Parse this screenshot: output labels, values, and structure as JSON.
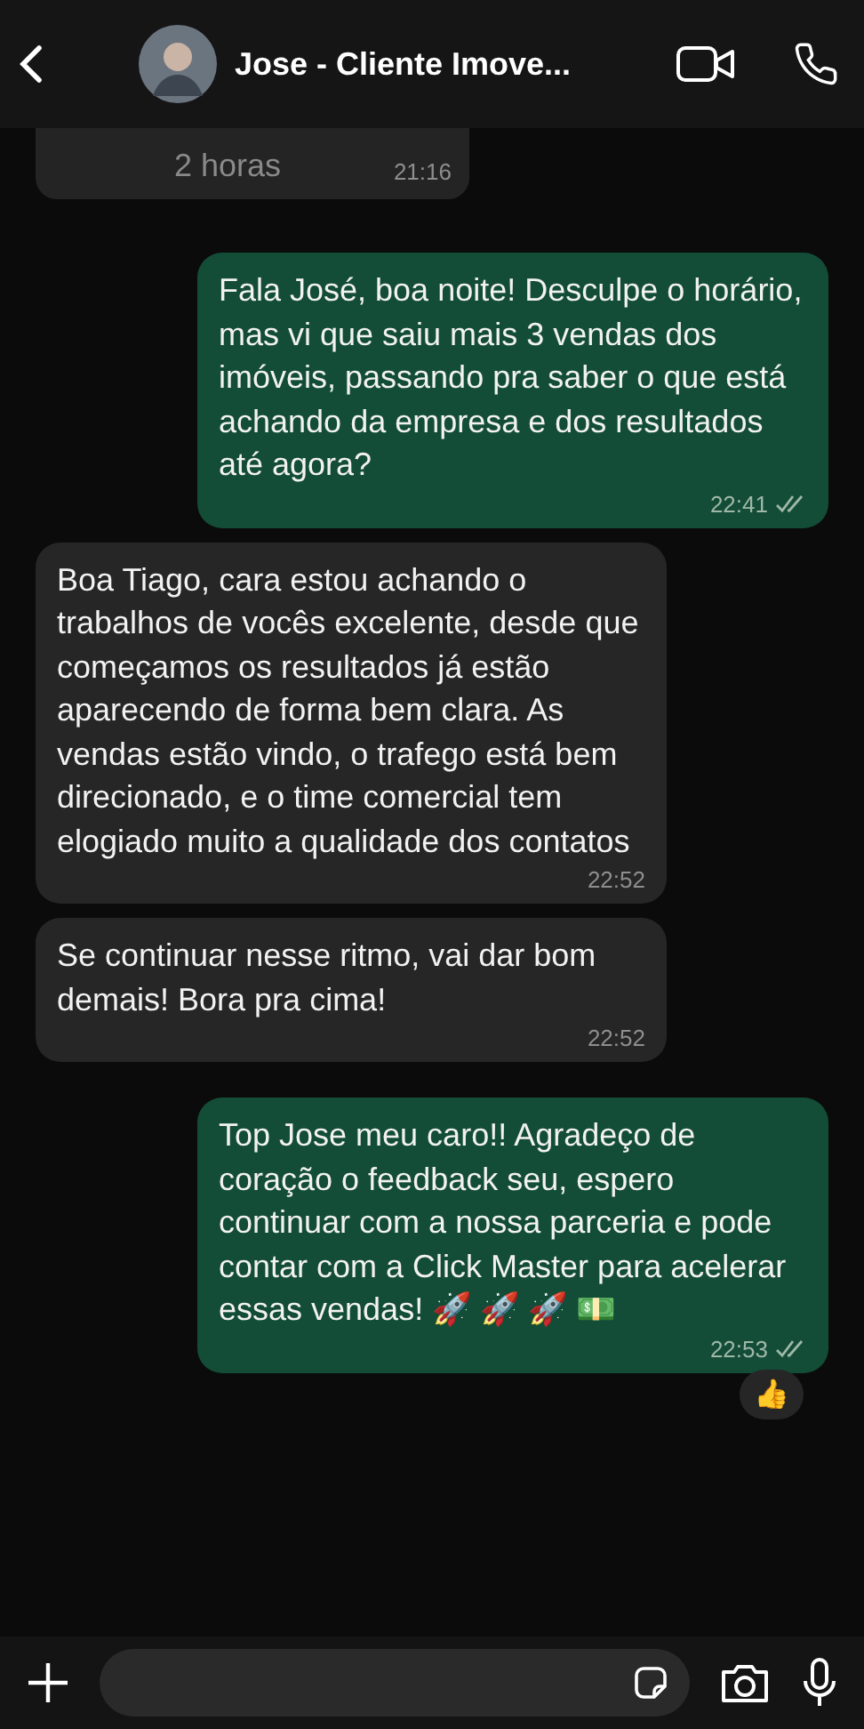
{
  "header": {
    "contact_name": "Jose - Cliente Imove..."
  },
  "partial_message": {
    "text": "2 horas",
    "time": "21:16"
  },
  "messages": [
    {
      "kind": "outgoing",
      "text": "Fala José, boa noite! Desculpe o horário, mas vi que saiu mais 3 vendas dos imóveis, passando pra saber o que está achando da empresa e dos resultados até agora?",
      "time": "22:41",
      "read": true
    },
    {
      "kind": "incoming",
      "text": "Boa Tiago, cara estou achando o trabalhos de vocês excelente, desde que começamos os resultados já estão aparecendo de forma bem clara. As vendas estão vindo, o trafego está bem direcionado, e o time comercial tem elogiado muito a qualidade dos contatos",
      "time": "22:52",
      "read": false
    },
    {
      "kind": "incoming",
      "text": "Se continuar nesse ritmo, vai dar bom demais! Bora pra cima!",
      "time": "22:52",
      "read": false
    },
    {
      "kind": "outgoing",
      "text": "Top Jose meu caro!! Agradeço de coração o feedback seu, espero continuar com a nossa parceria e pode contar com a Click Master para acelerar essas vendas! 🚀 🚀 🚀 💵",
      "time": "22:53",
      "read": true,
      "reaction": "👍"
    }
  ]
}
